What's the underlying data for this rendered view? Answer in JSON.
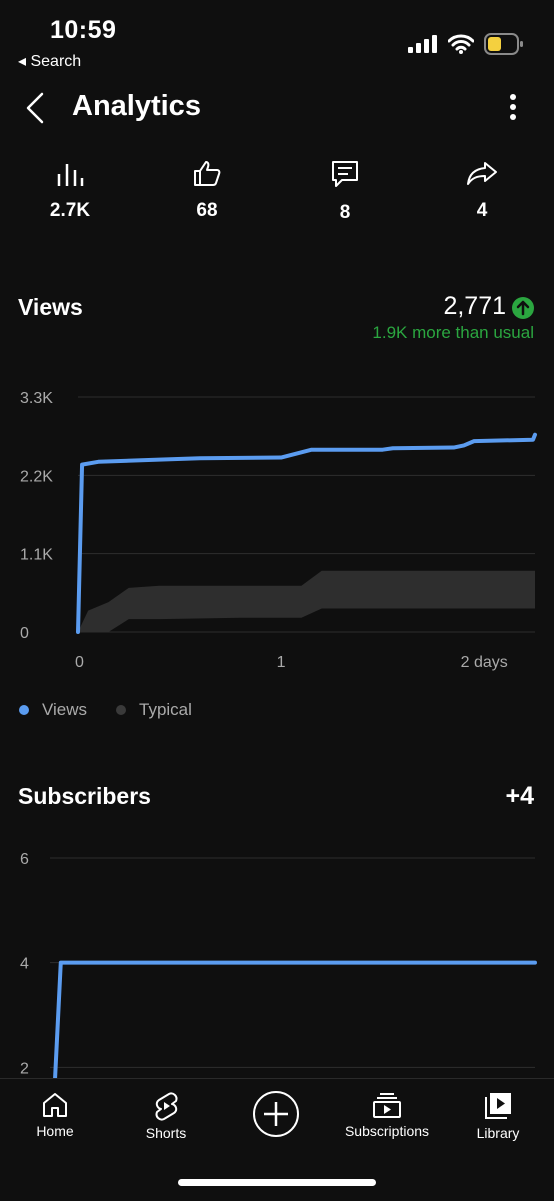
{
  "status_bar": {
    "time": "10:59",
    "back_label": "◂ Search"
  },
  "header": {
    "title": "Analytics"
  },
  "stats": [
    {
      "icon": "views-bars-icon",
      "value": "2.7K"
    },
    {
      "icon": "thumbs-up-icon",
      "value": "68"
    },
    {
      "icon": "comment-icon",
      "value": "8"
    },
    {
      "icon": "share-icon",
      "value": "4"
    }
  ],
  "views": {
    "title": "Views",
    "total": "2,771",
    "comparison": "1.9K more than usual",
    "legend": [
      "Views",
      "Typical"
    ]
  },
  "subscribers": {
    "title": "Subscribers",
    "total": "+4"
  },
  "chart_data": [
    {
      "type": "line",
      "title": "Views",
      "y_ticks": [
        "0",
        "1.1K",
        "2.2K",
        "3.3K"
      ],
      "x_ticks": [
        "0",
        "1",
        "2 days"
      ],
      "ylim": [
        0,
        3300
      ],
      "xlim": [
        0,
        2.25
      ],
      "grid": true,
      "legend_placement": "bottom-left",
      "series": [
        {
          "name": "Views",
          "color": "#5b9cf0",
          "x": [
            0,
            0.02,
            0.1,
            0.4,
            0.6,
            1.0,
            1.15,
            1.5,
            1.55,
            1.85,
            1.9,
            1.95,
            2.24,
            2.25
          ],
          "y": [
            0,
            2350,
            2390,
            2420,
            2440,
            2450,
            2560,
            2560,
            2580,
            2590,
            2620,
            2680,
            2700,
            2771
          ]
        },
        {
          "name": "Typical",
          "color": "#2e2e2e",
          "x": [
            0,
            0.05,
            0.15,
            0.25,
            0.4,
            0.8,
            1.1,
            1.2,
            2.25
          ],
          "y_low": [
            0,
            0,
            0,
            180,
            180,
            200,
            200,
            330,
            330
          ],
          "y_high": [
            0,
            300,
            420,
            620,
            650,
            650,
            650,
            860,
            860
          ]
        }
      ]
    },
    {
      "type": "line",
      "title": "Subscribers",
      "y_ticks": [
        "2",
        "4",
        "6"
      ],
      "ylim": [
        0,
        6
      ],
      "xlim": [
        0,
        2.25
      ],
      "grid": true,
      "series": [
        {
          "name": "Subscribers",
          "color": "#5b9cf0",
          "x": [
            0,
            0.02,
            0.05,
            2.25
          ],
          "y": [
            0.5,
            1.5,
            4,
            4
          ]
        }
      ]
    }
  ],
  "bottom_nav": [
    {
      "label": "Home"
    },
    {
      "label": "Shorts"
    },
    {
      "label": ""
    },
    {
      "label": "Subscriptions"
    },
    {
      "label": "Library"
    }
  ],
  "colors": {
    "accent": "#5b9cf0",
    "positive": "#2ba640",
    "background": "#0f0f0f"
  }
}
